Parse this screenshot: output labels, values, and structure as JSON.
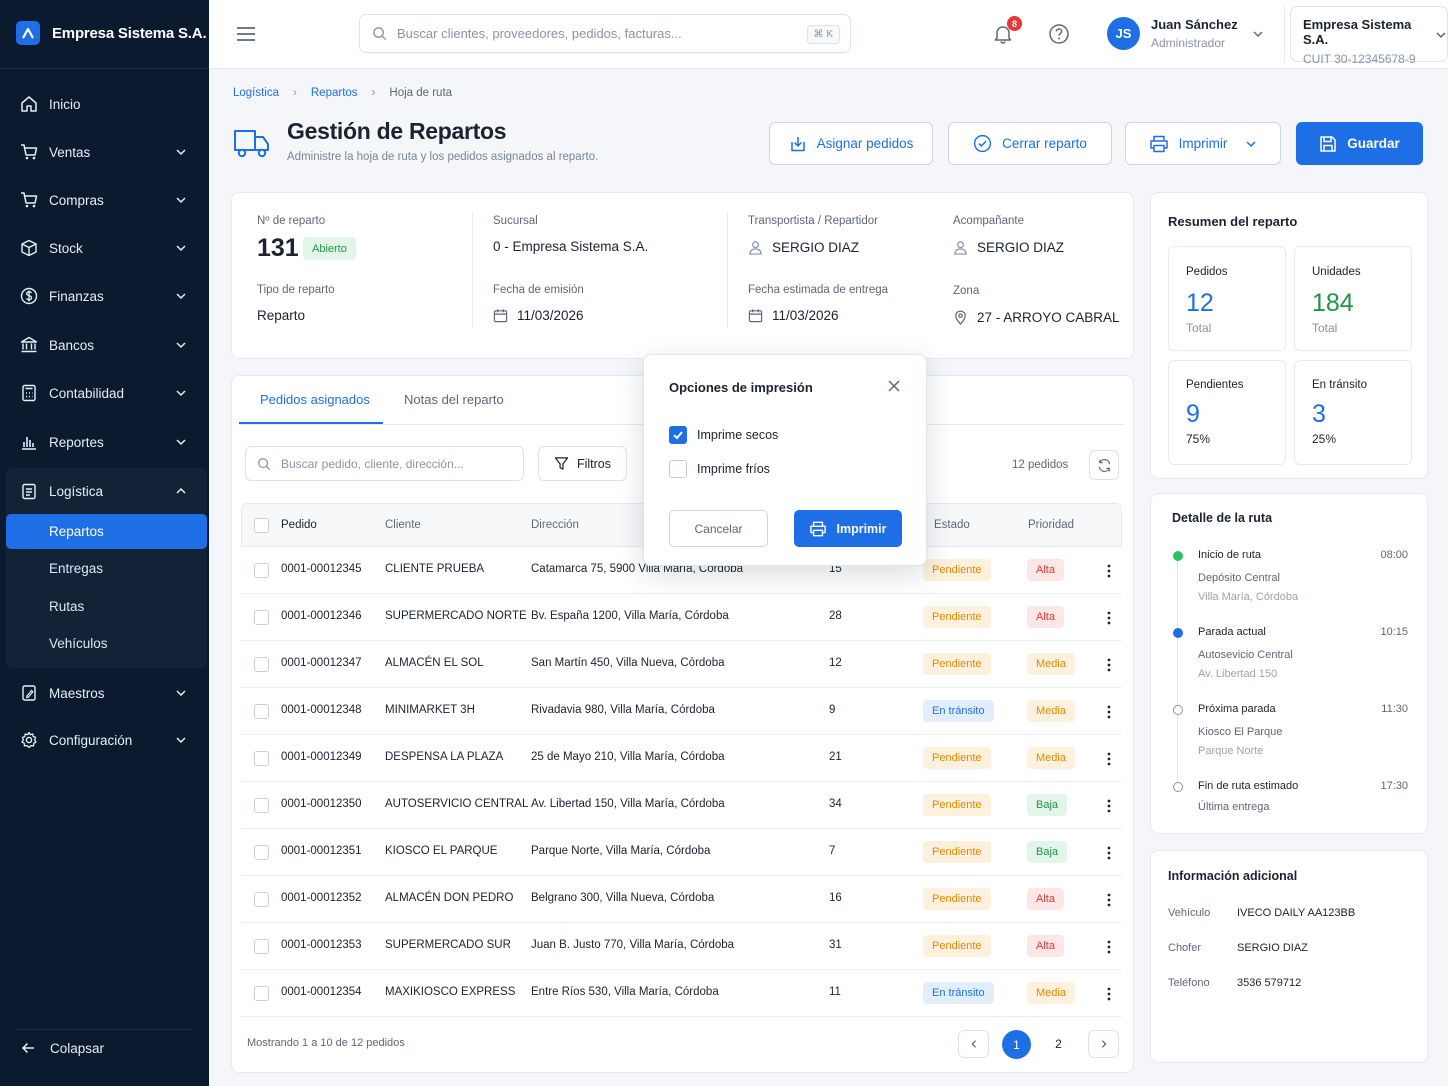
{
  "app": {
    "company_short": "Empresa Sistema S.A."
  },
  "sidebar": {
    "items": [
      {
        "label": "Inicio"
      },
      {
        "label": "Ventas"
      },
      {
        "label": "Compras"
      },
      {
        "label": "Stock"
      },
      {
        "label": "Finanzas"
      },
      {
        "label": "Bancos"
      },
      {
        "label": "Contabilidad"
      },
      {
        "label": "Reportes"
      },
      {
        "label": "Logística"
      },
      {
        "label": "Maestros"
      },
      {
        "label": "Configuración"
      }
    ],
    "logistica_sub": [
      {
        "label": "Repartos",
        "active": true
      },
      {
        "label": "Entregas"
      },
      {
        "label": "Rutas"
      },
      {
        "label": "Vehículos"
      }
    ],
    "collapse_label": "Colapsar"
  },
  "topbar": {
    "search_placeholder": "Buscar clientes, proveedores, pedidos, facturas...",
    "search_shortcut": "⌘ K",
    "notifications_count": "8",
    "user": {
      "initials": "JS",
      "name": "Juan Sánchez",
      "role": "Administrador"
    },
    "company": {
      "name": "Empresa Sistema S.A.",
      "cuit": "CUIT 30-12345678-9"
    }
  },
  "breadcrumb": [
    "Logística",
    "Repartos",
    "Hoja de ruta"
  ],
  "header": {
    "title": "Gestión de Repartos",
    "subtitle": "Administre la hoja de ruta y los pedidos asignados al reparto.",
    "buttons": {
      "assign": "Asignar pedidos",
      "close": "Cerrar reparto",
      "print": "Imprimir",
      "save": "Guardar"
    }
  },
  "info": {
    "numero_label": "Nº de reparto",
    "numero": "131",
    "estado": "Abierto",
    "sucursal_label": "Sucursal",
    "sucursal": "0 - Empresa Sistema S.A.",
    "transportista_label": "Transportista / Repartidor",
    "transportista": "SERGIO DIAZ",
    "acompanante_label": "Acompañante",
    "acompanante": "SERGIO DIAZ",
    "tipo_label": "Tipo de reparto",
    "tipo": "Reparto",
    "emision_label": "Fecha de emisión",
    "emision": "11/03/2026",
    "entrega_label": "Fecha estimada de entrega",
    "entrega": "11/03/2026",
    "zona_label": "Zona",
    "zona": "27 - ARROYO CABRAL"
  },
  "tabs": [
    {
      "label": "Pedidos asignados",
      "active": true
    },
    {
      "label": "Notas del reparto"
    }
  ],
  "table": {
    "search_placeholder": "Buscar pedido, cliente, dirección...",
    "filters_label": "Filtros",
    "count": "12 pedidos",
    "columns": {
      "pedido": "Pedido",
      "cliente": "Cliente",
      "direccion": "Dirección",
      "estado": "Estado",
      "prioridad": "Prioridad"
    },
    "rows": [
      {
        "pedido": "0001-00012345",
        "cliente": "CLIENTE PRUEBA",
        "direccion": "Catamarca 75, 5900 Villa María, Córdoba",
        "unidades": "15",
        "estado": "Pendiente",
        "prioridad": "Alta"
      },
      {
        "pedido": "0001-00012346",
        "cliente": "SUPERMERCADO NORTE",
        "direccion": "Bv. España 1200, Villa María, Córdoba",
        "unidades": "28",
        "estado": "Pendiente",
        "prioridad": "Alta"
      },
      {
        "pedido": "0001-00012347",
        "cliente": "ALMACÉN EL SOL",
        "direccion": "San Martín 450, Villa Nueva, Córdoba",
        "unidades": "12",
        "estado": "Pendiente",
        "prioridad": "Media"
      },
      {
        "pedido": "0001-00012348",
        "cliente": "MINIMARKET 3H",
        "direccion": "Rivadavia 980, Villa María, Córdoba",
        "unidades": "9",
        "estado": "En tránsito",
        "prioridad": "Media"
      },
      {
        "pedido": "0001-00012349",
        "cliente": "DESPENSA LA PLAZA",
        "direccion": "25 de Mayo 210, Villa María, Córdoba",
        "unidades": "21",
        "estado": "Pendiente",
        "prioridad": "Media"
      },
      {
        "pedido": "0001-00012350",
        "cliente": "AUTOSERVICIO CENTRAL",
        "direccion": "Av. Libertad 150, Villa María, Córdoba",
        "unidades": "34",
        "estado": "Pendiente",
        "prioridad": "Baja"
      },
      {
        "pedido": "0001-00012351",
        "cliente": "KIOSCO EL PARQUE",
        "direccion": "Parque Norte, Villa María, Córdoba",
        "unidades": "7",
        "estado": "Pendiente",
        "prioridad": "Baja"
      },
      {
        "pedido": "0001-00012352",
        "cliente": "ALMACÉN DON PEDRO",
        "direccion": "Belgrano 300, Villa Nueva, Córdoba",
        "unidades": "16",
        "estado": "Pendiente",
        "prioridad": "Alta"
      },
      {
        "pedido": "0001-00012353",
        "cliente": "SUPERMERCADO SUR",
        "direccion": "Juan B. Justo 770, Villa María, Córdoba",
        "unidades": "31",
        "estado": "Pendiente",
        "prioridad": "Alta"
      },
      {
        "pedido": "0001-00012354",
        "cliente": "MAXIKIOSCO EXPRESS",
        "direccion": "Entre Ríos 530, Villa María, Córdoba",
        "unidades": "11",
        "estado": "En tránsito",
        "prioridad": "Media"
      }
    ],
    "footer": "Mostrando 1 a 10 de 12 pedidos",
    "pages": [
      "1",
      "2"
    ]
  },
  "summary": {
    "title": "Resumen del reparto",
    "stats": [
      {
        "label": "Pedidos",
        "value": "12",
        "sub": "Total"
      },
      {
        "label": "Unidades",
        "value": "184",
        "sub": "Total"
      },
      {
        "label": "Pendientes",
        "value": "9",
        "sub": "75%"
      },
      {
        "label": "En tránsito",
        "value": "3",
        "sub": "25%"
      }
    ]
  },
  "route": {
    "title": "Detalle de la ruta",
    "steps": [
      {
        "title": "Inicio de ruta",
        "time": "08:00",
        "line1": "Depósito Central",
        "line2": "Villa María, Córdoba"
      },
      {
        "title": "Parada actual",
        "time": "10:15",
        "line1": "Autosevicio Central",
        "line2": "Av. Libertad 150"
      },
      {
        "title": "Próxima parada",
        "time": "11:30",
        "line1": "Kiosco El Parque",
        "line2": "Parque Norte"
      },
      {
        "title": "Fin de ruta estimado",
        "time": "17:30",
        "line1": "Última entrega"
      }
    ]
  },
  "extra": {
    "title": "Información adicional",
    "rows": [
      {
        "k": "Vehículo",
        "v": "IVECO DAILY AA123BB"
      },
      {
        "k": "Chofer",
        "v": "SERGIO DIAZ"
      },
      {
        "k": "Teléfono",
        "v": "3536 579712"
      }
    ]
  },
  "modal": {
    "title": "Opciones de impresión",
    "options": [
      {
        "label": "Imprime secos",
        "checked": true
      },
      {
        "label": "Imprime fríos",
        "checked": false
      }
    ],
    "cancel": "Cancelar",
    "print": "Imprimir"
  },
  "colors": {
    "primary": "#1e6fe6",
    "sidebar": "#0b1a2e",
    "success": "#22934a",
    "warning": "#e08a00",
    "danger": "#e53935"
  }
}
